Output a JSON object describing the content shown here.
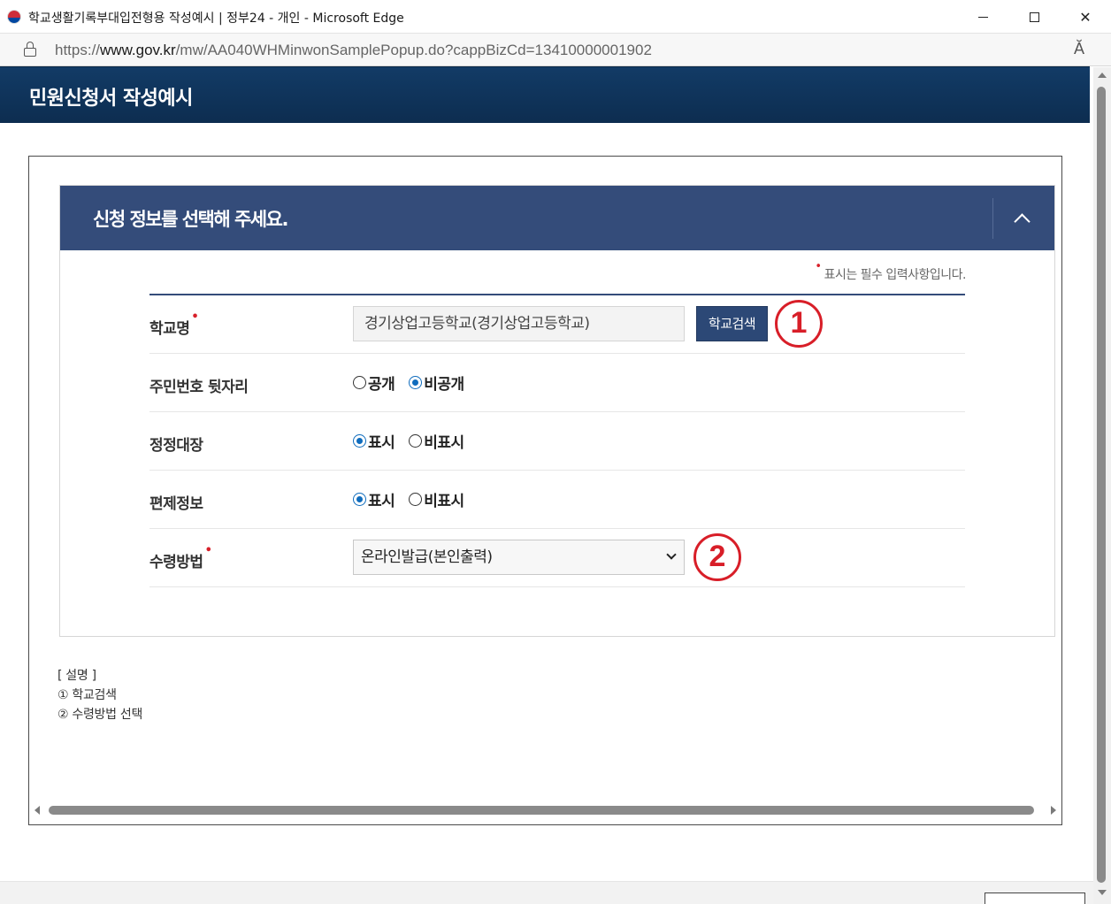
{
  "window": {
    "title": "학교생활기록부대입전형용 작성예시 | 정부24 - 개인 - Microsoft Edge",
    "controls": {
      "minimize_icon": "minimize-icon",
      "maximize_icon": "maximize-icon",
      "close_glyph": "✕"
    }
  },
  "address_bar": {
    "protocol": "https://",
    "host": "www.gov.kr",
    "path": "/mw/AA040WHMinwonSamplePopup.do?cappBizCd=13410000001902",
    "read_aloud": "Ă"
  },
  "page": {
    "title": "민원신청서 작성예시"
  },
  "panel": {
    "title": "신청 정보를 선택해 주세요.",
    "required_note": "표시는 필수 입력사항입니다.",
    "required_marker": "•"
  },
  "form": {
    "school": {
      "label": "학교명",
      "value": "경기상업고등학교(경기상업고등학교)",
      "search_button": "학교검색",
      "callout": "1"
    },
    "ssn_back": {
      "label": "주민번호 뒷자리",
      "options": [
        "공개",
        "비공개"
      ],
      "selected": "비공개"
    },
    "correction_ledger": {
      "label": "정정대장",
      "options": [
        "표시",
        "비표시"
      ],
      "selected": "표시"
    },
    "transfer_info": {
      "label": "편제정보",
      "options": [
        "표시",
        "비표시"
      ],
      "selected": "표시"
    },
    "receive_method": {
      "label": "수령방법",
      "selected": "온라인발급(본인출력)",
      "callout": "2"
    }
  },
  "explanation": {
    "heading": "[ 설명 ]",
    "items": [
      "① 학교검색",
      "② 수령방법 선택"
    ]
  },
  "colors": {
    "header_bg": "#123b66",
    "panel_header_bg": "#344c7a",
    "callout_red": "#d81e28",
    "radio_blue": "#0f6cbd"
  }
}
